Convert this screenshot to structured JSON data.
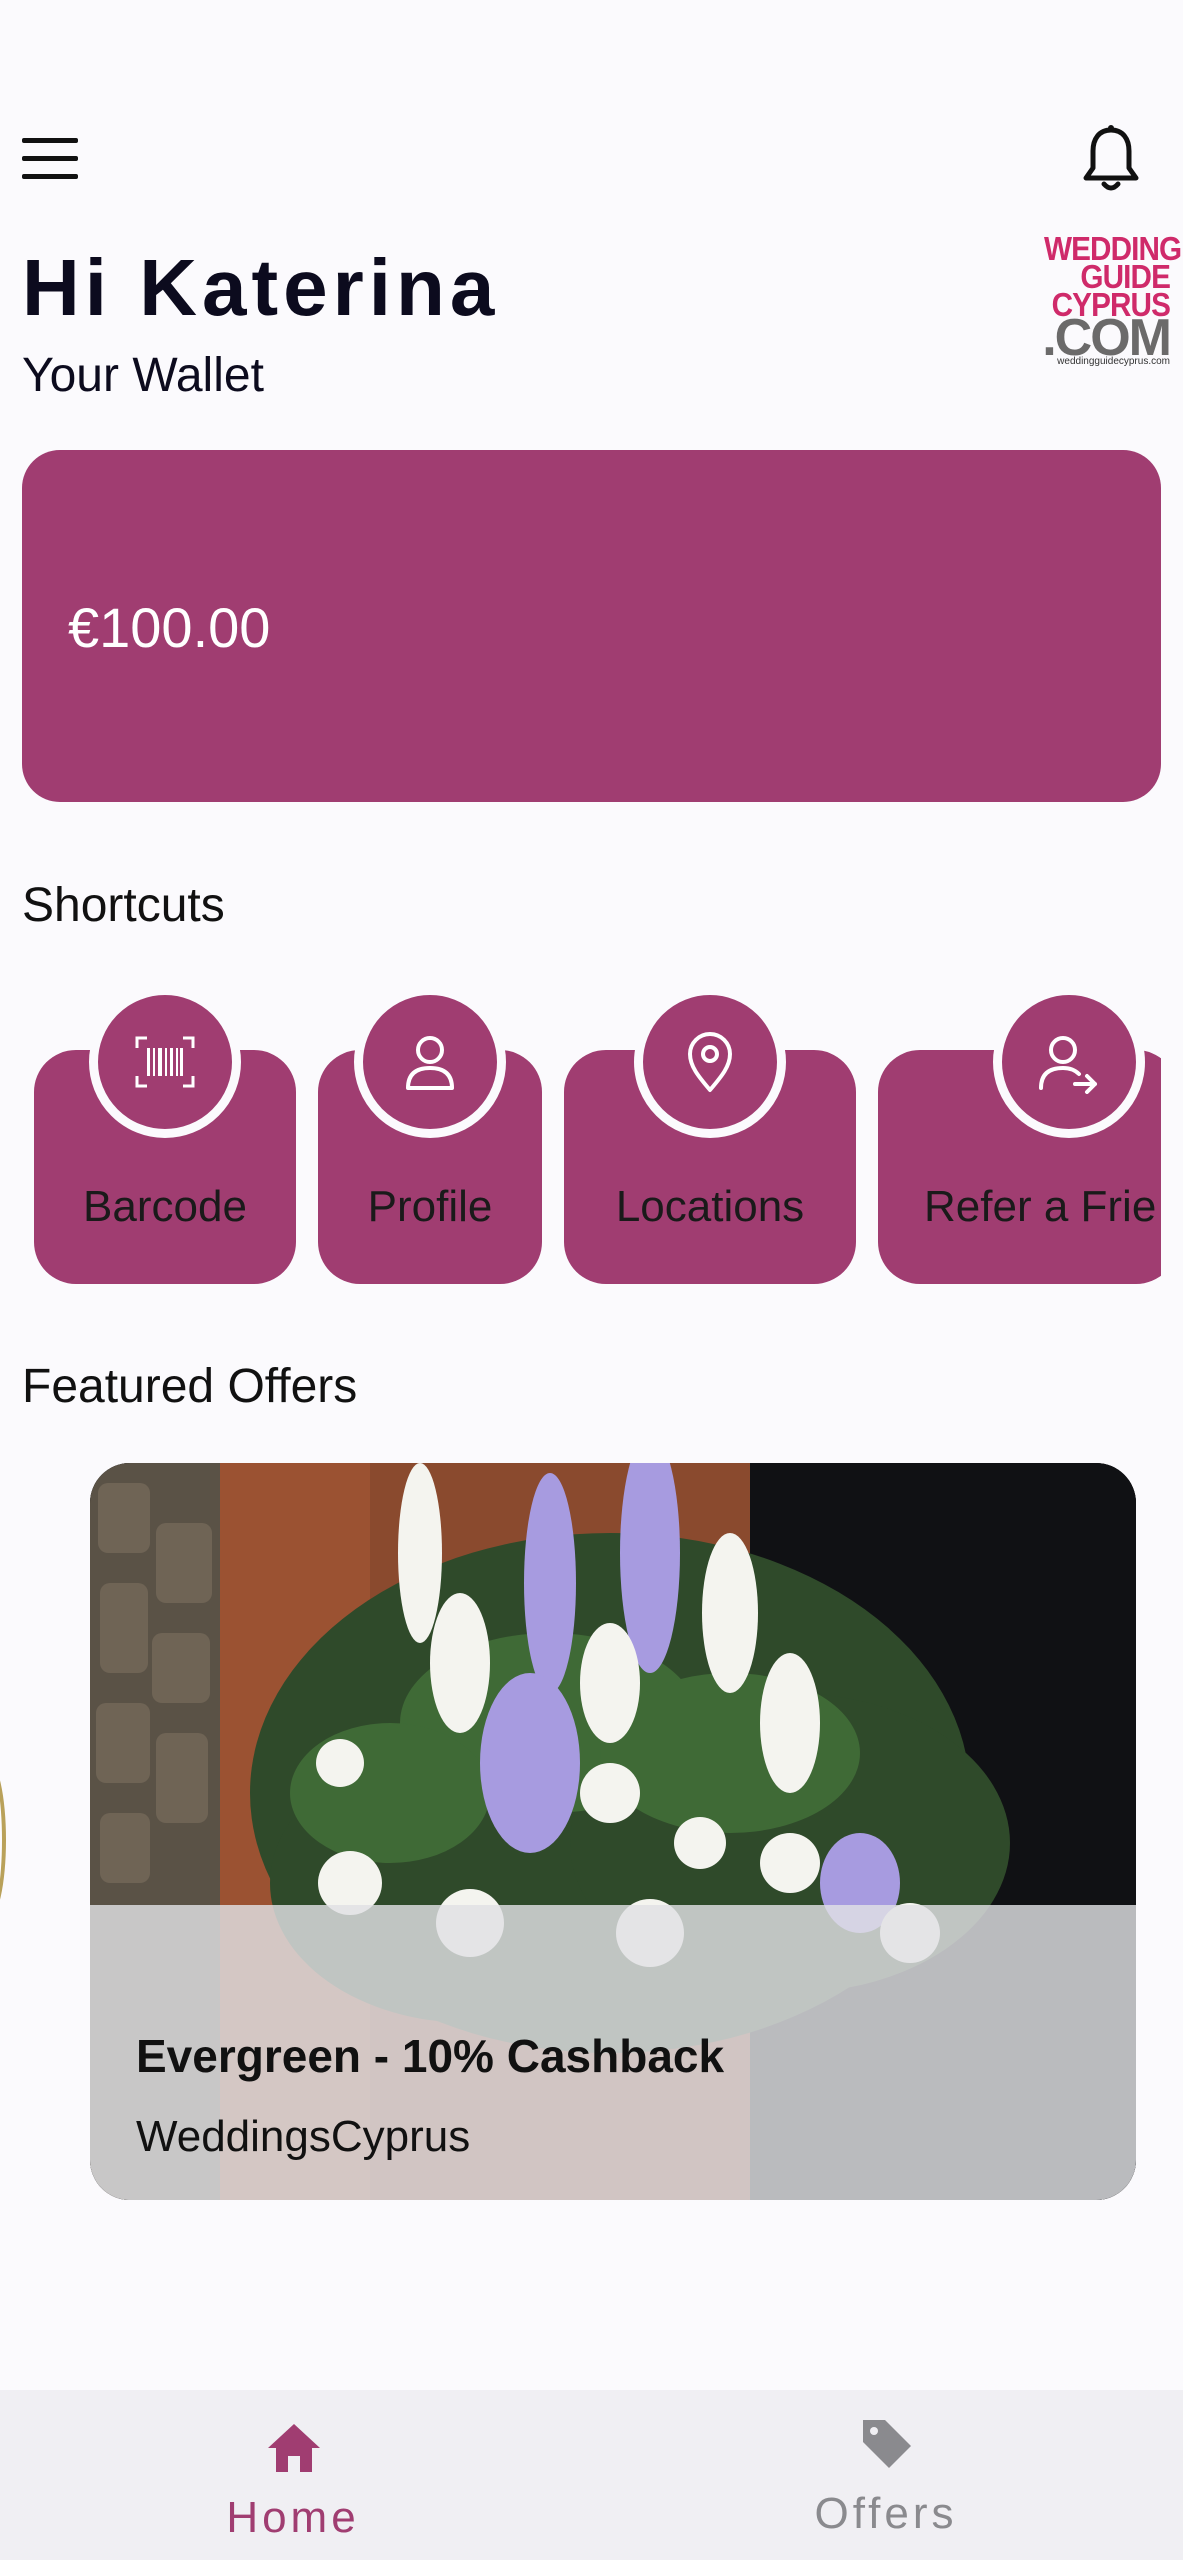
{
  "header": {
    "greeting": "Hi Katerina",
    "wallet_label": "Your Wallet",
    "logo_lines": [
      "WEDDING",
      "GUIDE",
      "CYPRUS",
      ".COM",
      "weddingguidecyprus.com"
    ],
    "menu_icon": "hamburger-menu-icon",
    "bell_icon": "bell-icon"
  },
  "wallet": {
    "amount": "€100.00",
    "card_color": "#a03d71"
  },
  "shortcuts": {
    "title": "Shortcuts",
    "items": [
      {
        "label": "Barcode",
        "icon": "barcode-icon"
      },
      {
        "label": "Profile",
        "icon": "user-icon"
      },
      {
        "label": "Locations",
        "icon": "location-pin-icon"
      },
      {
        "label": "Refer a Frie",
        "icon": "refer-user-icon"
      }
    ]
  },
  "featured": {
    "title": "Featured Offers",
    "offers": [
      {
        "title": "Evergreen - 10% Cashback",
        "merchant": "WeddingsCyprus",
        "image": "flower-arrangement-photo"
      }
    ]
  },
  "bottom_nav": {
    "items": [
      {
        "label": "Home",
        "icon": "home-icon",
        "active": true
      },
      {
        "label": "Offers",
        "icon": "tag-icon",
        "active": false
      }
    ],
    "active_color": "#a03d71",
    "inactive_color": "#8a8a8e"
  },
  "colors": {
    "brand": "#a03d71",
    "background": "#fbfafd",
    "logo_pink": "#cf2a6a"
  }
}
